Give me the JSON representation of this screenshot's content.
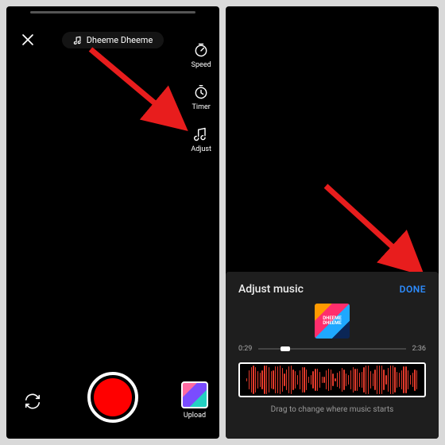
{
  "left": {
    "song": "Dheeme Dheeme",
    "tools": {
      "speed": "Speed",
      "timer": "Timer",
      "adjust": "Adjust"
    },
    "upload": "Upload"
  },
  "right": {
    "sheet_title": "Adjust music",
    "done": "DONE",
    "album_text": "DHEEME DHEEME",
    "time_start": "0:29",
    "time_end": "2:36",
    "hint": "Drag to change where music starts"
  },
  "colors": {
    "accent_blue": "#2d8cff",
    "record_red": "#ff0000",
    "arrow_red": "#e81d1d"
  }
}
